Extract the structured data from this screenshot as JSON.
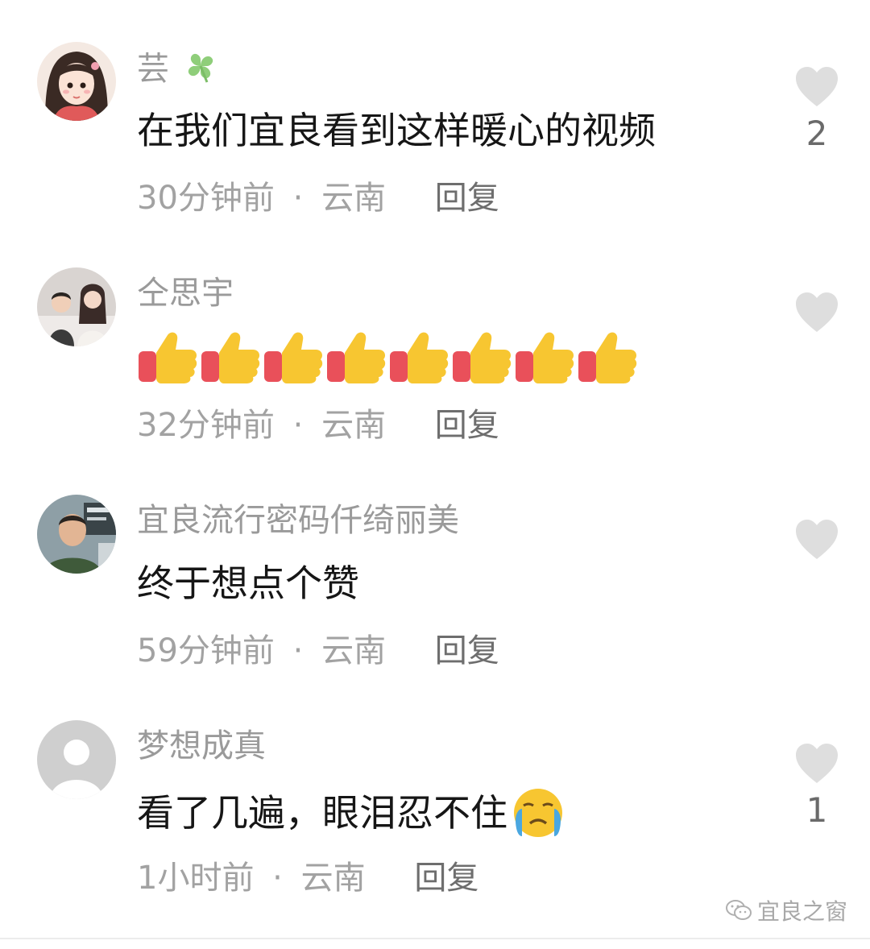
{
  "comments": [
    {
      "username": "芸",
      "username_badge": "four-leaf-clover-emoji",
      "text": "在我们宜良看到这样暖心的视频",
      "time": "30分钟前",
      "separator": "·",
      "location": "云南",
      "reply_label": "回复",
      "like_count": "2"
    },
    {
      "username": "仝思宇",
      "text": "",
      "emojis": [
        "thumbs-up-emoji",
        "thumbs-up-emoji",
        "thumbs-up-emoji",
        "thumbs-up-emoji",
        "thumbs-up-emoji",
        "thumbs-up-emoji",
        "thumbs-up-emoji",
        "thumbs-up-emoji"
      ],
      "time": "32分钟前",
      "separator": "·",
      "location": "云南",
      "reply_label": "回复",
      "like_count": ""
    },
    {
      "username": "宜良流行密码仟绮丽美",
      "text": "终于想点个赞",
      "time": "59分钟前",
      "separator": "·",
      "location": "云南",
      "reply_label": "回复",
      "like_count": ""
    },
    {
      "username": "梦想成真",
      "text": "看了几遍，眼泪忍不住",
      "text_trailing_emoji": "loudly-crying-face-emoji",
      "time": "1小时前",
      "separator": "·",
      "location": "云南",
      "reply_label": "回复",
      "like_count": "1"
    }
  ],
  "watermark": {
    "icon": "wechat-icon",
    "text": "宜良之窗"
  },
  "colors": {
    "username": "#9a9a9a",
    "content": "#161616",
    "meta": "#a2a2a2",
    "reply": "#6e6e6e",
    "heart": "#dedede"
  }
}
